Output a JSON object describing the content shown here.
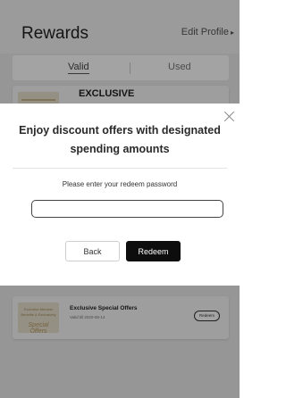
{
  "header": {
    "title": "Rewards",
    "edit_profile": "Edit Profile",
    "edit_profile_chevron": "▸"
  },
  "tabs": [
    {
      "label": "Valid"
    },
    {
      "label": "Used"
    }
  ],
  "cards": [
    {
      "title": "EXCLUSIVE"
    },
    {
      "thumb_lines": [
        "Exclusive Member",
        "Benefits & Exclusively"
      ],
      "thumb_big": "Special Offers",
      "title": "Exclusive Special Offers",
      "valid": "Valid till 2020-08-14",
      "redeem_label": "Redeem"
    }
  ],
  "modal": {
    "title_line1": "Enjoy discount offers with designated",
    "title_line2": "spending amounts",
    "prompt": "Please enter your redeem password",
    "password_value": "",
    "back_label": "Back",
    "redeem_label": "Redeem",
    "close_icon": "close-icon"
  },
  "colors": {
    "overlay": "#00000060",
    "primary_button": "#0d0d0d",
    "page_bg": "#ebebeb"
  }
}
